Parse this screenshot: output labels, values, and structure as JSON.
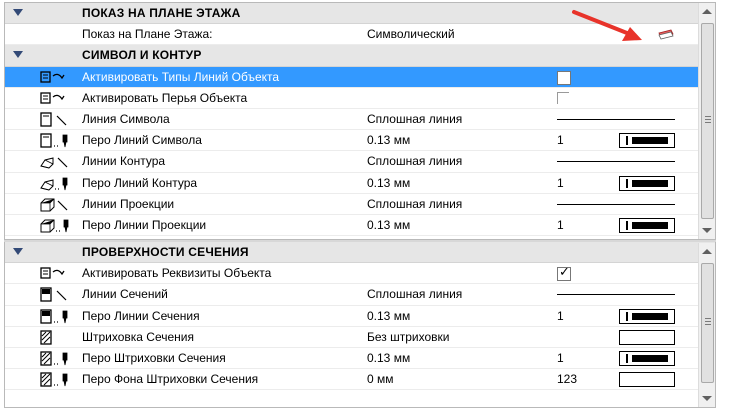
{
  "colors": {
    "header_bg": "#e6e6e6",
    "selected_bg": "#3399ff",
    "triangle": "#334a77",
    "annotation_arrow": "#e8332a"
  },
  "floor_plan": {
    "title": "ПОКАЗ НА ПЛАНЕ ЭТАЖА",
    "rows": [
      {
        "label": "Показ на Плане Этажа:",
        "value": "Символический",
        "icon": "floor-plan-swatch-icon"
      }
    ]
  },
  "symbol_contour": {
    "title": "СИМВОЛ И КОНТУР",
    "rows": [
      {
        "label": "Активировать Типы Линий Объекта",
        "checkbox": "unchecked",
        "selected": true,
        "icon": "object-linetype-icon"
      },
      {
        "label": "Активировать Перья Объекта",
        "checkbox": "disabled",
        "icon": "object-pen-icon"
      },
      {
        "label": "Линия Символа",
        "value": "Сплошная линия",
        "preview": "solid-line",
        "icon": "symbol-line-icon"
      },
      {
        "label": "Перо Линий Символа",
        "value": "0.13 мм",
        "pen_number": "1",
        "preview": "pen",
        "icon": "symbol-pen-icon"
      },
      {
        "label": "Линии Контура",
        "value": "Сплошная линия",
        "preview": "solid-line",
        "icon": "contour-line-icon"
      },
      {
        "label": "Перо Линий Контура",
        "value": "0.13 мм",
        "pen_number": "1",
        "preview": "pen",
        "icon": "contour-pen-icon"
      },
      {
        "label": "Линии Проекции",
        "value": "Сплошная линия",
        "preview": "solid-line",
        "icon": "projection-line-icon"
      },
      {
        "label": "Перо Линии Проекции",
        "value": "0.13 мм",
        "pen_number": "1",
        "preview": "pen",
        "icon": "projection-pen-icon"
      }
    ]
  },
  "cut_surfaces": {
    "title": "ПРОВЕРХНОСТИ СЕЧЕНИЯ",
    "rows": [
      {
        "label": "Активировать Реквизиты Объекта",
        "checkbox": "checked",
        "icon": "object-attributes-icon"
      },
      {
        "label": "Линии Сечений",
        "value": "Сплошная линия",
        "preview": "solid-line",
        "icon": "cut-line-icon"
      },
      {
        "label": "Перо Линии Сечения",
        "value": "0.13 мм",
        "pen_number": "1",
        "preview": "pen",
        "icon": "cut-pen-icon"
      },
      {
        "label": "Штриховка Сечения",
        "value": "Без штриховки",
        "preview": "empty-box",
        "icon": "cut-fill-icon"
      },
      {
        "label": "Перо Штриховки Сечения",
        "value": "0.13 мм",
        "pen_number": "1",
        "preview": "pen",
        "icon": "cut-fill-pen-icon"
      },
      {
        "label": "Перо Фона Штриховки Сечения",
        "value": "0 мм",
        "pen_number": "123",
        "preview": "empty-box",
        "icon": "cut-fill-bg-pen-icon"
      }
    ]
  }
}
